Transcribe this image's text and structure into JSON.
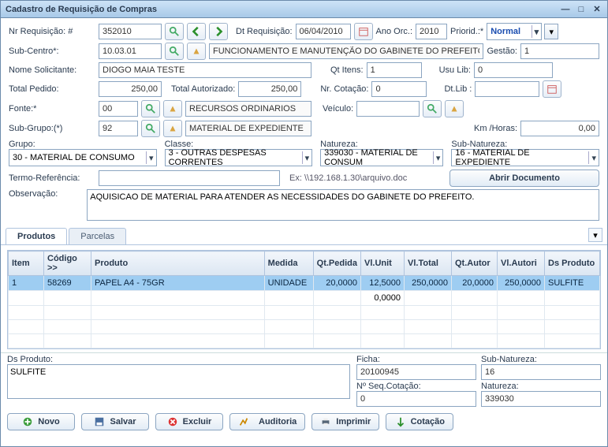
{
  "window": {
    "title": "Cadastro de Requisição de Compras"
  },
  "labels": {
    "nr_req": "Nr Requisição: #",
    "dt_req": "Dt Requisição:",
    "ano_orc": "Ano Orc.:",
    "priorid": "Priorid.:*",
    "sub_centro": "Sub-Centro*:",
    "gestao": "Gestão:",
    "nome_sol": "Nome Solicitante:",
    "qt_itens": "Qt Itens:",
    "usu_lib": "Usu Lib:",
    "total_pedido": "Total Pedido:",
    "total_aut": "Total Autorizado:",
    "nr_cot": "Nr. Cotação:",
    "dt_lib": "Dt.Lib :",
    "fonte": "Fonte:*",
    "veiculo": "Veículo:",
    "sub_grupo": "Sub-Grupo:(*)",
    "km_horas": "Km /Horas:",
    "grupo": "Grupo:",
    "classe": "Classe:",
    "natureza": "Natureza:",
    "sub_nat": "Sub-Natureza:",
    "termo_ref": "Termo-Referência:",
    "ex": "Ex: \\\\192.168.1.30\\arquivo.doc",
    "abrir_doc": "Abrir Documento",
    "obs": "Observação:",
    "ds_produto": "Ds Produto:",
    "ficha": "Ficha:",
    "no_seq": "Nº Seq.Cotação:",
    "natureza2": "Natureza:",
    "sub_nat2": "Sub-Natureza:"
  },
  "values": {
    "nr_req": "352010",
    "dt_req": "06/04/2010",
    "ano_orc": "2010",
    "priorid": "Normal",
    "sub_centro": "10.03.01",
    "sub_centro_desc": "FUNCIONAMENTO E MANUTENÇÃO DO GABINETE DO PREFEITO -",
    "gestao": "1",
    "nome_sol": "DIOGO MAIA TESTE",
    "qt_itens": "1",
    "usu_lib": "0",
    "total_pedido": "250,00",
    "total_aut": "250,00",
    "nr_cot": "0",
    "dt_lib": "",
    "fonte": "00",
    "fonte_desc": "RECURSOS ORDINARIOS",
    "veiculo": "",
    "sub_grupo": "92",
    "sub_grupo_desc": "MATERIAL DE EXPEDIENTE",
    "km_horas": "0,00",
    "grupo": "30 - MATERIAL DE CONSUMO",
    "classe": "3 - OUTRAS DESPESAS CORRENTES",
    "natureza": "339030 - MATERIAL DE CONSUM",
    "sub_nat": "16 - MATERIAL DE EXPEDIENTE",
    "termo_ref": "",
    "obs": "AQUISICAO DE MATERIAL PARA ATENDER AS NECESSIDADES DO GABINETE DO PREFEITO.",
    "ds_produto_text": "SULFITE",
    "ficha": "20100945",
    "sub_nat2": "16",
    "no_seq": "0",
    "natureza2": "339030"
  },
  "tabs": {
    "produtos": "Produtos",
    "parcelas": "Parcelas"
  },
  "grid": {
    "headers": [
      "Item",
      "Código >>",
      "Produto",
      "Medida",
      "Qt.Pedida",
      "Vl.Unit",
      "Vl.Total",
      "Qt.Autor",
      "Vl.Autori",
      "Ds Produto"
    ],
    "rows": [
      {
        "item": "1",
        "codigo": "58269",
        "produto": "PAPEL A4 - 75GR",
        "medida": "UNIDADE",
        "qtped": "20,0000",
        "vlunit": "12,5000",
        "vltotal": "250,0000",
        "qtaut": "20,0000",
        "vlaut": "250,0000",
        "dsprod": "SULFITE"
      }
    ],
    "sum_vlunit": "0,0000"
  },
  "actions": {
    "novo": "Novo",
    "salvar": "Salvar",
    "excluir": "Excluir",
    "auditoria": "Auditoria",
    "imprimir": "Imprimir",
    "cotacao": "Cotação"
  }
}
